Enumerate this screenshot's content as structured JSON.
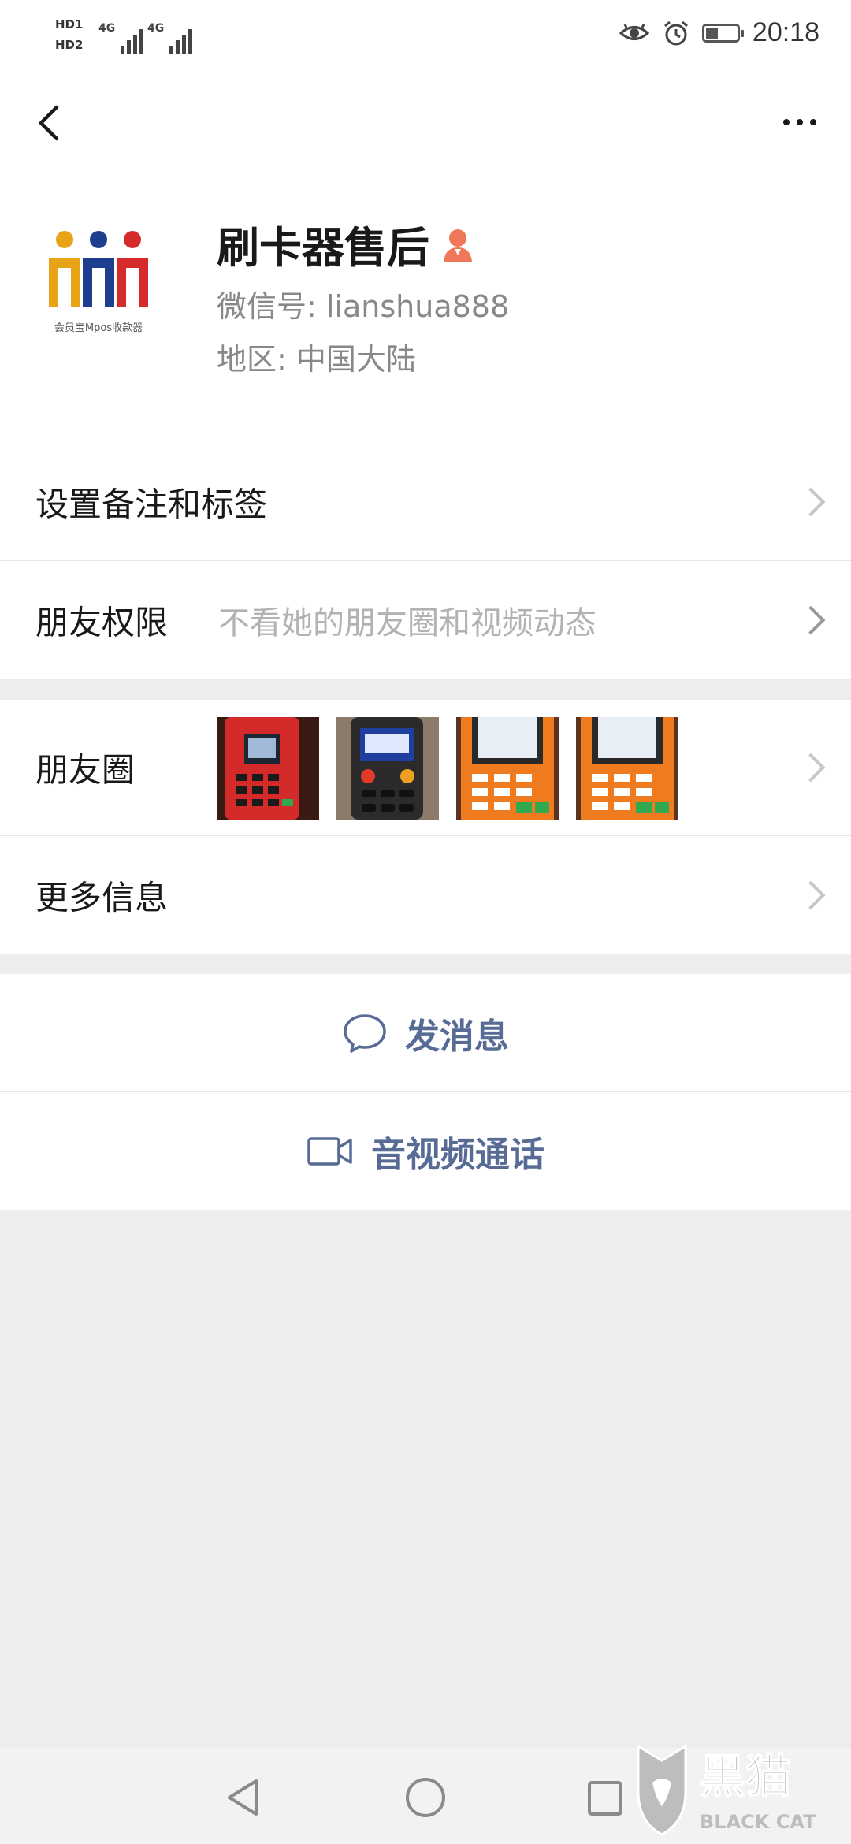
{
  "status_bar": {
    "sim1": "HD1",
    "sim2": "HD2",
    "net1": "4G",
    "net2": "4G",
    "time": "20:18",
    "battery_level": 0.4,
    "icons": [
      "eye-icon",
      "alarm-icon",
      "battery-icon"
    ]
  },
  "nav": {
    "back_icon": "back-arrow-icon",
    "more_icon": "more-dots-icon"
  },
  "profile": {
    "name": "刷卡器售后",
    "wechat_id": "微信号: lianshua888",
    "region": "地区: 中国大陆",
    "avatar_caption": "会员宝Mpos收款器",
    "badge_icon": "customer-service-icon"
  },
  "settings": {
    "remark_label": "设置备注和标签",
    "permission_label": "朋友权限",
    "permission_value": "不看她的朋友圈和视频动态"
  },
  "info": {
    "moments_label": "朋友圈",
    "moments_photos": [
      "card-reader-photo-1",
      "card-reader-photo-2",
      "card-reader-photo-3",
      "card-reader-photo-4"
    ],
    "more_label": "更多信息"
  },
  "actions": {
    "message_label": "发消息",
    "call_label": "音视频通话",
    "link_color": "#576b95"
  },
  "system_nav": [
    "back-triangle-icon",
    "home-circle-icon",
    "recents-square-icon"
  ],
  "watermark": {
    "text_cn": "黑猫",
    "text_en": "BLACK CAT"
  }
}
